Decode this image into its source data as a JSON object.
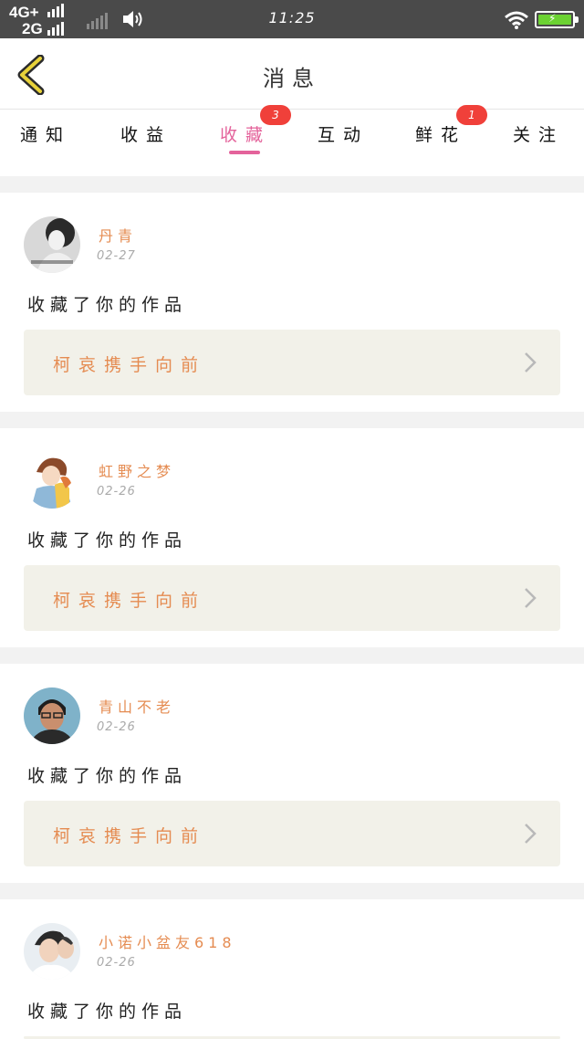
{
  "status_bar": {
    "network_top": "4G+",
    "network_bottom": "2G",
    "time": "11:25"
  },
  "header": {
    "title": "消息",
    "back_icon": "chevron-left-icon"
  },
  "tabs": [
    {
      "label": "通知",
      "badge": ""
    },
    {
      "label": "收益",
      "badge": ""
    },
    {
      "label": "收藏",
      "badge": "3",
      "active": true
    },
    {
      "label": "互动",
      "badge": ""
    },
    {
      "label": "鲜花",
      "badge": "1"
    },
    {
      "label": "关注",
      "badge": ""
    }
  ],
  "items": [
    {
      "user": "丹青",
      "date": "02-27",
      "action": "收藏了你的作品",
      "work": "柯哀携手向前"
    },
    {
      "user": "虹野之梦",
      "date": "02-26",
      "action": "收藏了你的作品",
      "work": "柯哀携手向前"
    },
    {
      "user": "青山不老",
      "date": "02-26",
      "action": "收藏了你的作品",
      "work": "柯哀携手向前"
    },
    {
      "user": "小诺小盆友618",
      "date": "02-26",
      "action": "收藏了你的作品",
      "work": ""
    }
  ],
  "colors": {
    "accent": "#e4639b",
    "username": "#e58c52",
    "badge": "#f0403a",
    "back_icon": "#e8d23a"
  }
}
